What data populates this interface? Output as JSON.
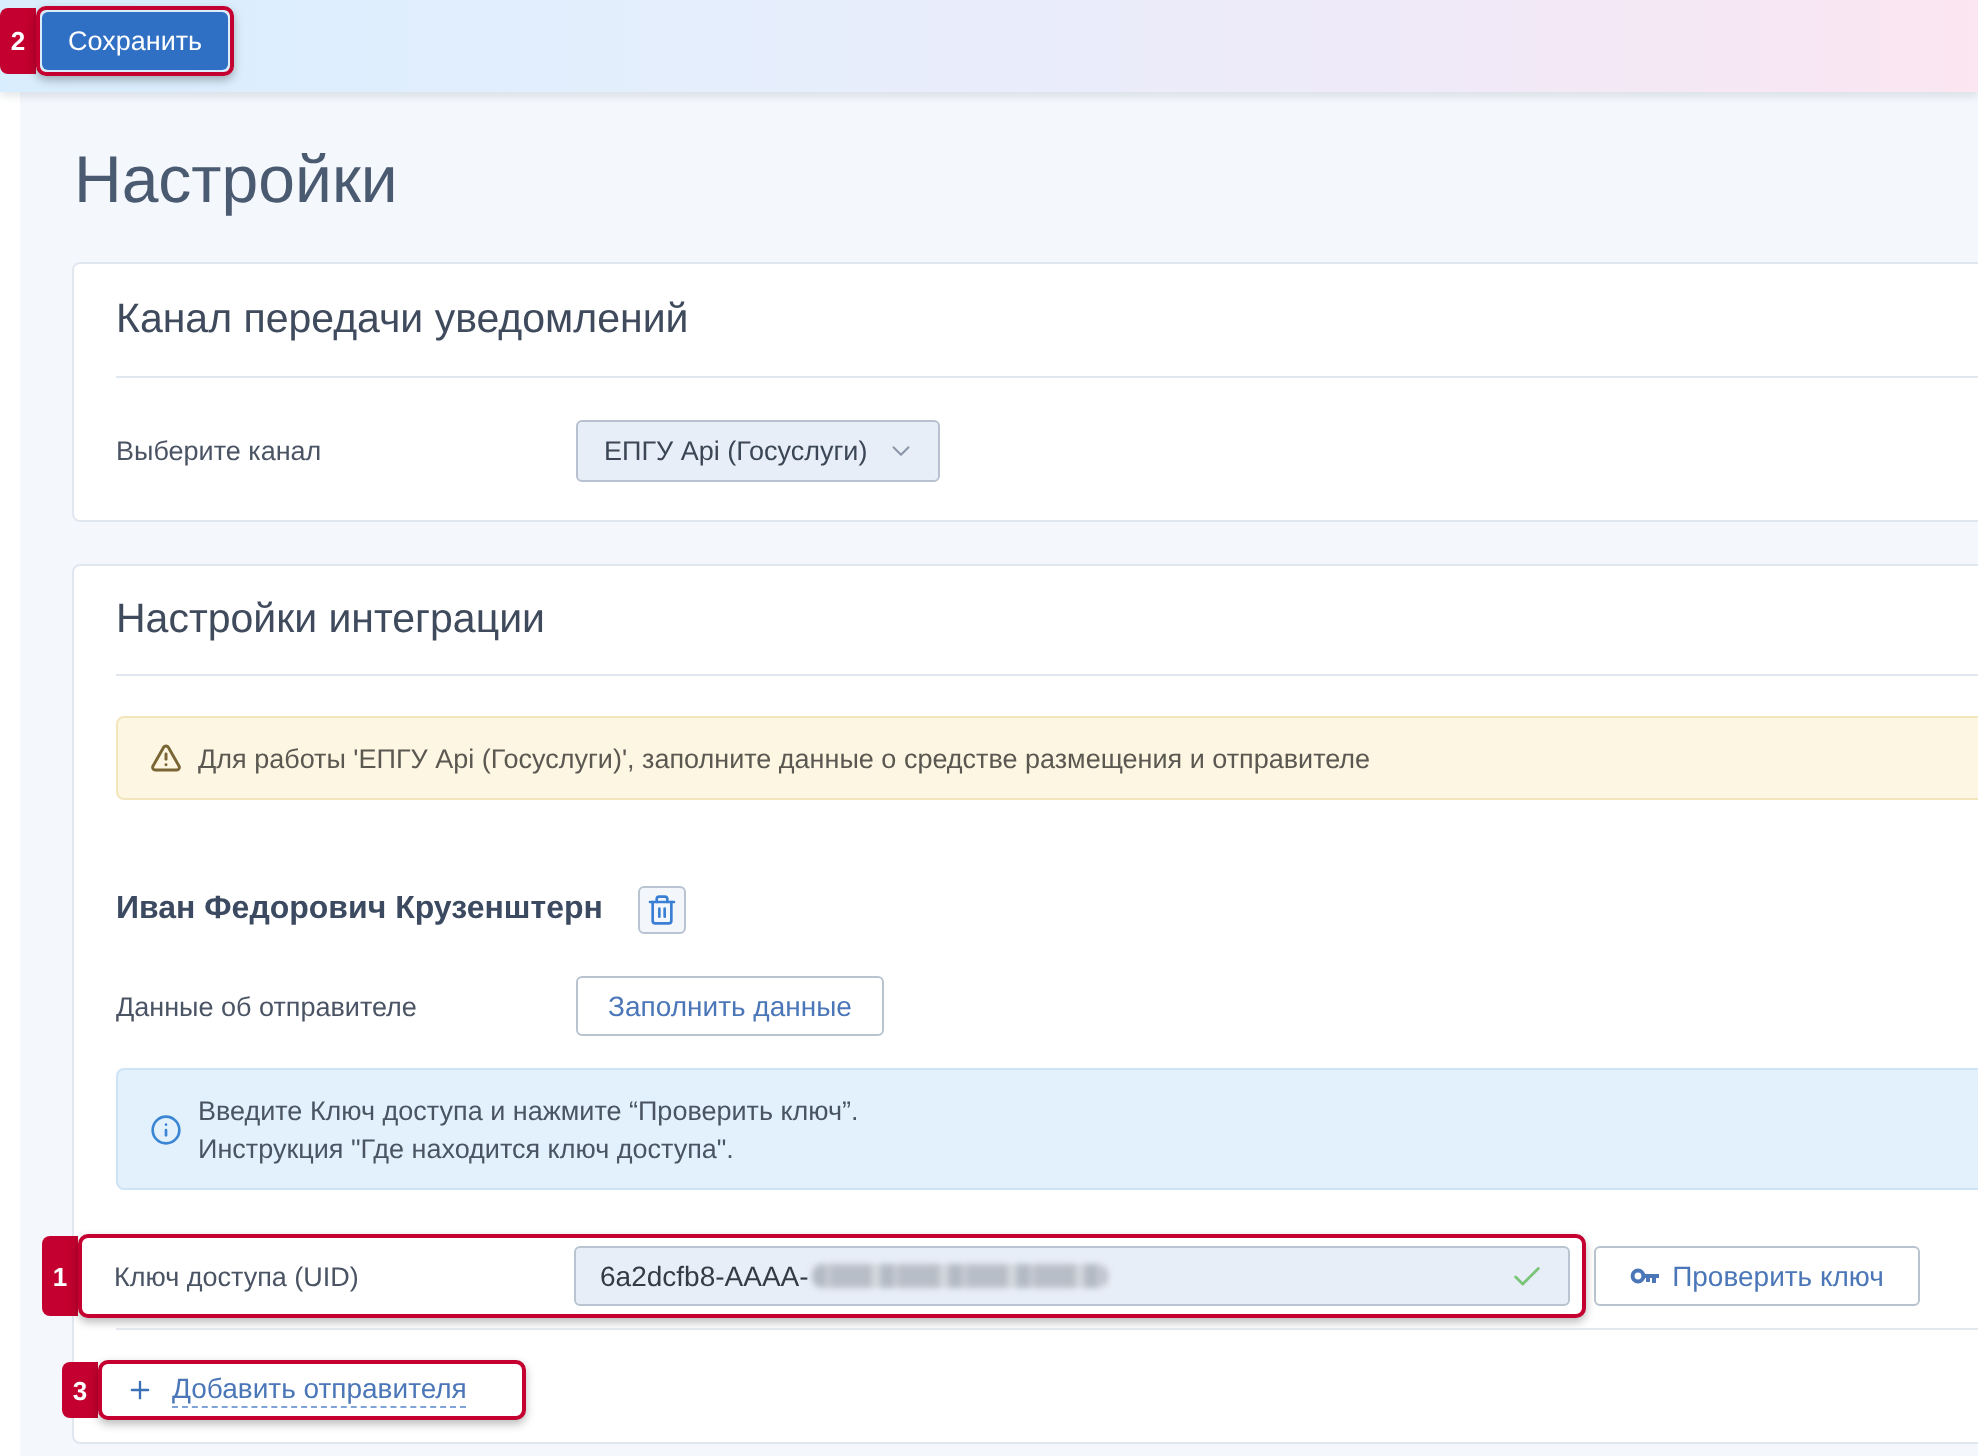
{
  "toolbar": {
    "save_button": {
      "label": "Сохранить",
      "callout": "2"
    }
  },
  "page_title": "Настройки",
  "channel_card": {
    "title": "Канал передачи уведомлений",
    "field_label": "Выберите канал",
    "select_value": "ЕПГУ Api (Госуслуги)"
  },
  "integration_card": {
    "title": "Настройки интеграции",
    "warning": "Для работы 'ЕПГУ Api (Госуслуги)', заполните данные о средстве размещения и отправителе",
    "senders": [
      {
        "name": "Иван Федорович Крузенштерн",
        "data_label": "Данные об отправителе",
        "fill_button": "Заполнить данные",
        "info_lines": [
          "Введите Ключ доступа и нажмите “Проверить ключ”.",
          "Инструкция \"Где находится ключ доступа\"."
        ],
        "key_label": "Ключ доступа (UID)",
        "key_value": "6a2dcfb8-AAAA-",
        "key_valid": true,
        "key_callout": "1",
        "check_button": "Проверить ключ"
      }
    ],
    "add_sender": {
      "label": "Добавить отправителя",
      "callout": "3"
    }
  }
}
